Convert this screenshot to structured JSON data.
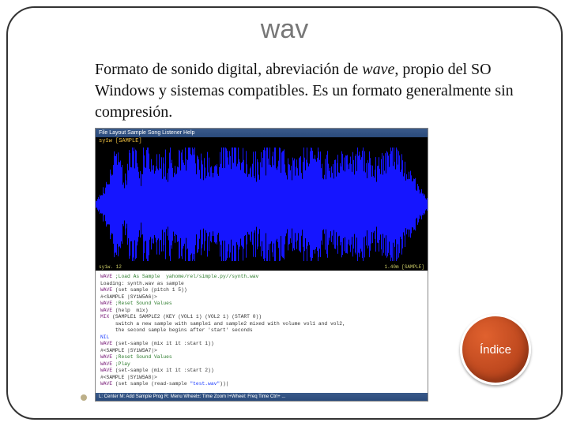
{
  "title": "wav",
  "body": {
    "prefix": "Formato de sonido digital, abreviación de ",
    "italic": "wave",
    "suffix": ", propio del SO Windows y sistemas compatibles. Es un formato generalmente sin compresión."
  },
  "screenshot": {
    "titlebar": "File  Layout  Sample  Song  Listener  Help",
    "toplabel": "sy1w  [SAMPLE]",
    "status_left": "sy1w. 12",
    "status_right": "1.40m  [SAMPLE]",
    "console_lines": [
      {
        "cls": "kw",
        "text": "WAVE"
      },
      {
        "cls": "cmt",
        "text": " ;Load As Sample  yahome/rel/simple.py//synth.wav"
      },
      {
        "cls": "",
        "text": "Loading: synth.wav as sample"
      },
      {
        "cls": "kw",
        "text": "WAVE"
      },
      {
        "cls": "",
        "text": " (set sample (pitch 1 5))"
      },
      {
        "cls": "",
        "text": "#<SAMPLE |SY1W5A6|>"
      },
      {
        "cls": "kw",
        "text": "WAVE"
      },
      {
        "cls": "cmt",
        "text": " ;Reset Sound Values"
      },
      {
        "cls": "kw",
        "text": "WAVE"
      },
      {
        "cls": "",
        "text": " (help  mix)"
      },
      {
        "cls": "kw",
        "text": "MIX"
      },
      {
        "cls": "",
        "text": " (SAMPLE1 SAMPLE2 (KEY (VOL1 1) (VOL2 1) (START 0))"
      },
      {
        "cls": "",
        "text": "     switch a new sample with sample1 and sample2 mixed with volume vol1 and vol2,"
      },
      {
        "cls": "",
        "text": "     the second sample begins after 'start' seconds"
      },
      {
        "cls": "num",
        "text": "NIL"
      },
      {
        "cls": "kw",
        "text": "WAVE"
      },
      {
        "cls": "",
        "text": " (set-sample (mix it it :start 1))"
      },
      {
        "cls": "",
        "text": "#<SAMPLE |SY1W5A7|>"
      },
      {
        "cls": "kw",
        "text": "WAVE"
      },
      {
        "cls": "cmt",
        "text": " ;Reset Sound Values"
      },
      {
        "cls": "kw",
        "text": "WAVE"
      },
      {
        "cls": "cmt",
        "text": " ;Play"
      },
      {
        "cls": "kw",
        "text": "WAVE"
      },
      {
        "cls": "",
        "text": " (set-sample (mix it it :start 2))"
      },
      {
        "cls": "",
        "text": "#<SAMPLE |SY1W5A8|>"
      },
      {
        "cls": "kw",
        "text": "WAVE"
      },
      {
        "cls": "",
        "text": " (set sample (read-sample "
      },
      {
        "cls": "num",
        "text": "\"test.wav\""
      },
      {
        "cls": "",
        "text": "))|"
      }
    ],
    "bottombar": "L: Center  M: Add Sample Prog  R: Menu  Wheel±: Time Zoom  I+Wheel: Freq Time  Ctrl+ ..."
  },
  "indice_label": "Índice"
}
